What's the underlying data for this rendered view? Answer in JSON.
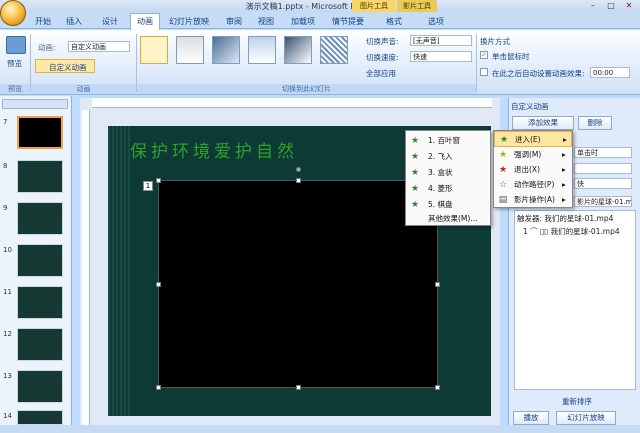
{
  "window": {
    "title": "演示文稿1.pptx - Microsoft PowerPoint",
    "context_tab_1": "图片工具",
    "context_tab_2": "影片工具",
    "minimize": "–",
    "maximize": "□",
    "close": "✕"
  },
  "tabs": [
    {
      "label": "开始"
    },
    {
      "label": "插入"
    },
    {
      "label": "设计"
    },
    {
      "label": "动画"
    },
    {
      "label": "幻灯片放映"
    },
    {
      "label": "审阅"
    },
    {
      "label": "视图"
    },
    {
      "label": "加载项"
    },
    {
      "label": "情节提要"
    },
    {
      "label": "格式"
    },
    {
      "label": "选项"
    }
  ],
  "ribbon": {
    "preview_label": "预览",
    "preview_group": "预览",
    "animation_label": "动画:",
    "animation_value": "自定义动画",
    "custom_anim_label": "自定义动画",
    "animation_group": "动画",
    "sound_label": "切换声音:",
    "sound_value": "[无声音]",
    "speed_label": "切换速度:",
    "speed_value": "快速",
    "apply_all_label": "全部应用",
    "transition_group": "切换到此幻灯片",
    "advance_title": "换片方式",
    "on_click_label": "单击鼠标时",
    "auto_after_label": "在此之后自动设置动画效果:",
    "auto_after_value": "00:00"
  },
  "slides_panel": {
    "slides": [
      "7",
      "8",
      "9",
      "10",
      "11",
      "12",
      "13",
      "14"
    ]
  },
  "slide": {
    "title": "保护环境爱护自然",
    "tag_number": "1"
  },
  "context_menu": {
    "items": [
      {
        "label": "1. 百叶窗"
      },
      {
        "label": "2. 飞入"
      },
      {
        "label": "3. 盒状"
      },
      {
        "label": "4. 菱形"
      },
      {
        "label": "5. 棋盘"
      },
      {
        "label": "其他效果(M)..."
      }
    ]
  },
  "sub_menu": {
    "items": [
      {
        "label": "进入(E)"
      },
      {
        "label": "强调(M)"
      },
      {
        "label": "退出(X)"
      },
      {
        "label": "动作路径(P)"
      },
      {
        "label": "影片操作(A)"
      }
    ]
  },
  "task_pane": {
    "title": "自定义动画",
    "add_effect": "添加效果",
    "remove": "删除",
    "start_value": "单击时",
    "speed_value": "快",
    "trigger_value": "影片的星球-01.mp4",
    "trigger_label": "触发器: 我们的星球-01.mp4",
    "list_item": "1 ⌒ ▯▯ 我们的星球-01.mp4",
    "reorder": "重新排序",
    "play": "播放",
    "slideshow": "幻灯片放映"
  }
}
